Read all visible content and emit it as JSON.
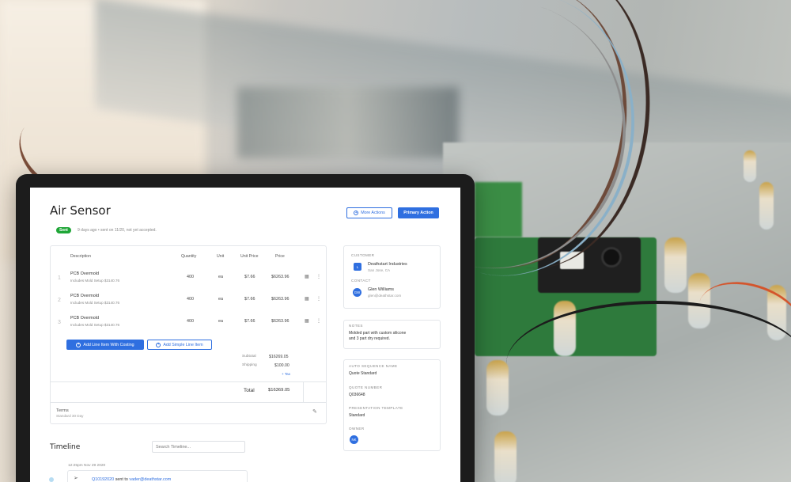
{
  "page": {
    "title": "Air Sensor",
    "status_badge": "Sent",
    "status_text": "9 days ago • sent on 11/20, not yet accepted.",
    "more_actions_label": "More Actions",
    "primary_action_label": "Primary Action"
  },
  "line_items": {
    "headers": {
      "description": "Description",
      "quantity": "Quantity",
      "unit": "Unit",
      "unit_price": "Unit Price",
      "price": "Price"
    },
    "rows": [
      {
        "num": "1",
        "name": "PCB Overmold",
        "sub": "Includes Mold Setup $3140.76",
        "quantity": "400",
        "unit": "ea",
        "unit_price": "$7.66",
        "price": "$6263.96"
      },
      {
        "num": "2",
        "name": "PCB Overmold",
        "sub": "Includes Mold Setup $3140.76",
        "quantity": "400",
        "unit": "ea",
        "unit_price": "$7.66",
        "price": "$6263.96"
      },
      {
        "num": "3",
        "name": "PCB Overmold",
        "sub": "Includes Mold Setup $3140.76",
        "quantity": "400",
        "unit": "ea",
        "unit_price": "$7.66",
        "price": "$6263.96"
      }
    ],
    "add_costing_label": "Add Line Item With Costing",
    "add_simple_label": "Add Simple Line Item",
    "subtotal_label": "Subtotal",
    "subtotal_value": "$16269.05",
    "shipping_label": "Shipping",
    "shipping_value": "$100.00",
    "tax_link": "+ Tax",
    "total_label": "Total",
    "total_value": "$16369.05",
    "terms_label": "Terms",
    "terms_value": "Standard 30 Day"
  },
  "timeline": {
    "title": "Timeline",
    "search_placeholder": "Search Timeline...",
    "entries": [
      {
        "time": "12:25pm Nov 29 2020",
        "quote_link": "Q10192020",
        "text": "sent to",
        "email": "vader@deathstar.com"
      }
    ]
  },
  "customer": {
    "customer_label": "CUSTOMER",
    "company_initial": "L",
    "company_name": "Deathstart Industries",
    "company_location": "San Jose, CA",
    "contact_label": "CONTACT",
    "contact_initials": "GW",
    "contact_name": "Glen Williams",
    "contact_email": "glen@deathstar.com"
  },
  "notes": {
    "label": "NOTES",
    "text_line1": "Molded part with custom silicone",
    "text_line2": "and 3 part dry required."
  },
  "details": {
    "auto_seq_label": "AUTO SEQUENCE NAME",
    "auto_seq_value": "Quote Standard",
    "quote_num_label": "QUOTE NUMBER",
    "quote_num_value": "Q036648",
    "template_label": "PRESENTATION TEMPLATE",
    "template_value": "Standard",
    "owner_label": "OWNER",
    "owner_initials": "NK"
  },
  "colors": {
    "accent": "#2f6fe0",
    "success": "#1fa637"
  }
}
